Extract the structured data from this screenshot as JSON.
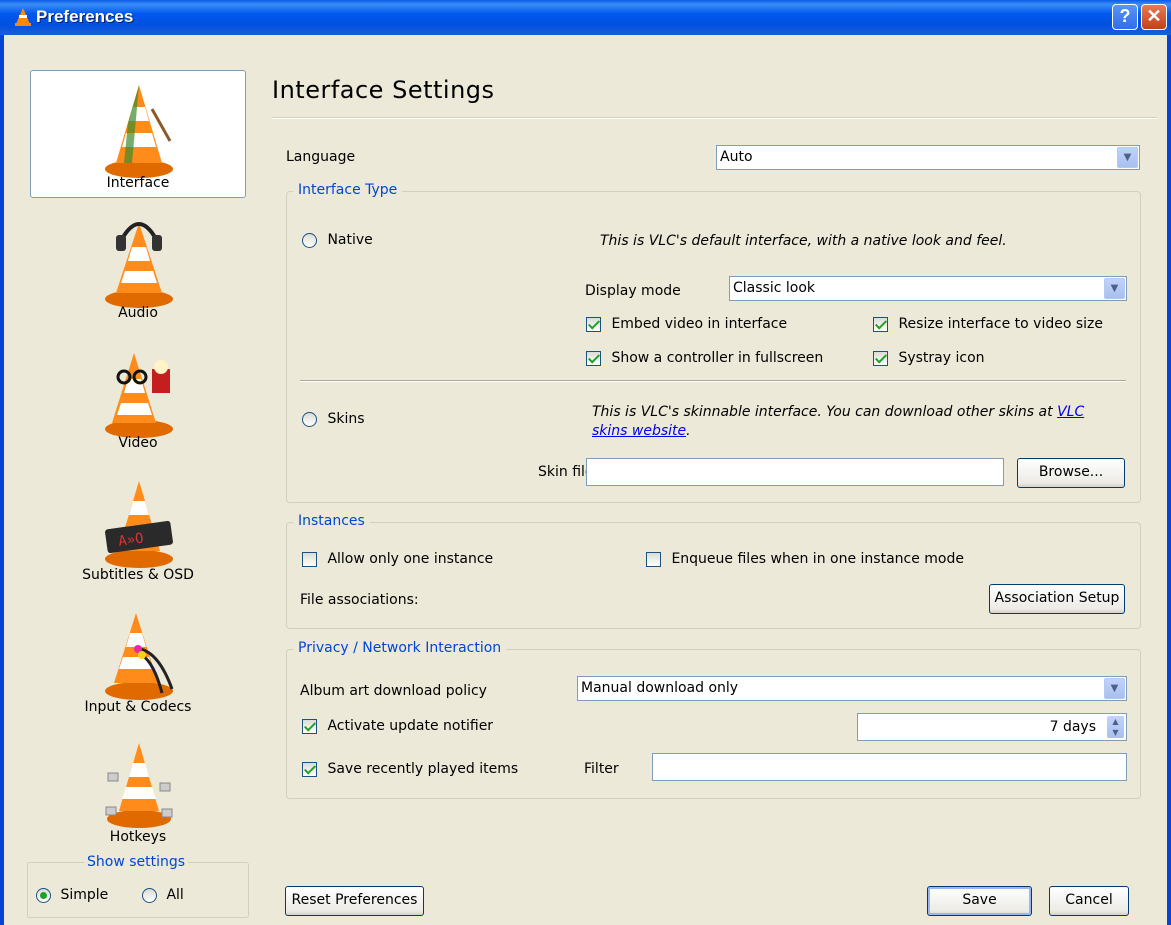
{
  "window": {
    "title": "Preferences",
    "help_icon": "help-icon",
    "close_icon": "close-icon"
  },
  "sidebar": {
    "items": [
      {
        "label": "Interface",
        "icon": "interface-cone-icon",
        "selected": true
      },
      {
        "label": "Audio",
        "icon": "audio-cone-icon",
        "selected": false
      },
      {
        "label": "Video",
        "icon": "video-cone-icon",
        "selected": false
      },
      {
        "label": "Subtitles & OSD",
        "icon": "subtitles-cone-icon",
        "selected": false
      },
      {
        "label": "Input & Codecs",
        "icon": "input-cone-icon",
        "selected": false
      },
      {
        "label": "Hotkeys",
        "icon": "hotkeys-cone-icon",
        "selected": false
      }
    ],
    "show_settings": {
      "legend": "Show settings",
      "simple": "Simple",
      "all": "All",
      "selected": "Simple"
    }
  },
  "main": {
    "heading": "Interface Settings",
    "language": {
      "label": "Language",
      "value": "Auto"
    },
    "interface_type": {
      "legend": "Interface Type",
      "native": {
        "label": "Native",
        "description": "This is VLC's default interface, with a native look and feel."
      },
      "display_mode": {
        "label": "Display mode",
        "value": "Classic look"
      },
      "embed_video": {
        "label": "Embed video in interface",
        "checked": true
      },
      "resize_interface": {
        "label": "Resize interface to video size",
        "checked": true
      },
      "show_controller": {
        "label": "Show a controller in fullscreen",
        "checked": true
      },
      "systray": {
        "label": "Systray icon",
        "checked": true
      },
      "skins": {
        "label": "Skins",
        "description": "This is VLC's skinnable interface. You can download other skins at ",
        "link": "VLC skins website",
        "link_suffix": "."
      },
      "skin_file": {
        "label": "Skin file",
        "value": ""
      },
      "browse_label": "Browse..."
    },
    "instances": {
      "legend": "Instances",
      "one_instance": {
        "label": "Allow only one instance",
        "checked": false
      },
      "enqueue": {
        "label": "Enqueue files when in one instance mode",
        "checked": false
      },
      "file_assoc_label": "File associations:",
      "assoc_button": "Association Setup"
    },
    "privacy": {
      "legend": "Privacy / Network Interaction",
      "album_art": {
        "label": "Album art download policy",
        "value": "Manual download only"
      },
      "update_notifier": {
        "label": "Activate update notifier",
        "checked": true,
        "value": "7 days"
      },
      "recent_items": {
        "label": "Save recently played items",
        "checked": true
      },
      "filter": {
        "label": "Filter",
        "value": ""
      }
    },
    "footer": {
      "reset": "Reset Preferences",
      "save": "Save",
      "cancel": "Cancel"
    }
  }
}
